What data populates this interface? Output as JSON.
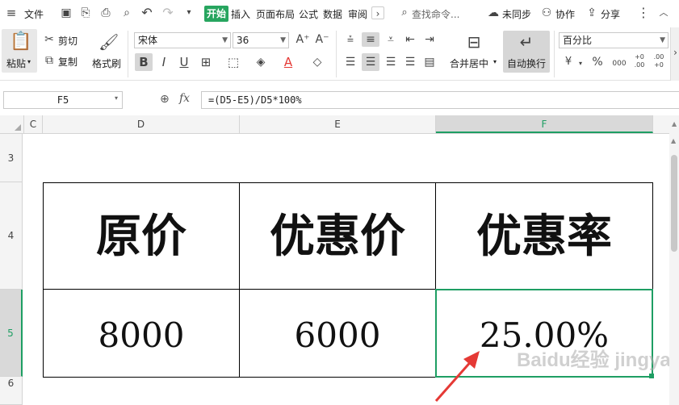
{
  "menu": {
    "file": "文件",
    "tabs": [
      "开始",
      "插入",
      "页面布局",
      "公式",
      "数据",
      "审阅"
    ],
    "search": "查找命令...",
    "sync": "未同步",
    "collab": "协作",
    "share": "分享"
  },
  "ribbon": {
    "paste": "粘贴",
    "cut": "剪切",
    "copy": "复制",
    "format_painter": "格式刷",
    "font_name": "宋体",
    "font_size": "36",
    "merge": "合并居中",
    "wrap": "自动换行",
    "number_format": "百分比",
    "currency": "¥",
    "percent": "%",
    "thousands": "000",
    "inc_dec": "+0 .00",
    "dec_dec": ".00 +0"
  },
  "formula_bar": {
    "cell_ref": "F5",
    "fx": "fx",
    "formula": "=(D5-E5)/D5*100%"
  },
  "columns": [
    "C",
    "D",
    "E",
    "F"
  ],
  "rows": [
    "3",
    "4",
    "5",
    "6"
  ],
  "table": {
    "headers": [
      "原价",
      "优惠价",
      "优惠率"
    ],
    "values": [
      "8000",
      "6000",
      "25.00%"
    ]
  },
  "watermark": "Baidu经验 jingyan.baidu.com",
  "colors": {
    "accent": "#27a55f",
    "selection": "#1e9e63",
    "arrow": "#e53935"
  }
}
